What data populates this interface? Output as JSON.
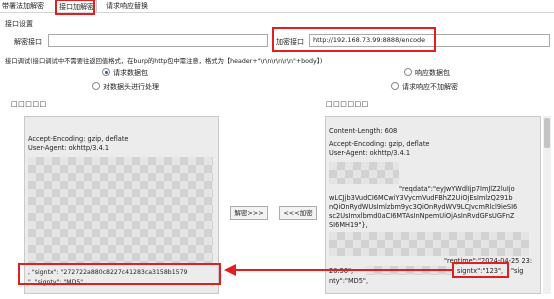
{
  "tabs": [
    {
      "label": "带署法加解密"
    },
    {
      "label": "接口加解密"
    },
    {
      "label": "请求响应替换"
    }
  ],
  "interface_settings": {
    "group_label": "接口设置",
    "decrypt_label": "解密接口",
    "decrypt_value": "",
    "encrypt_label": "加密接口",
    "encrypt_value": "http://192.168.73.99:8888/encode"
  },
  "instructions": "接口调试(接口调试中不需要往返回值格式，在burp的http包中需注意，格式为【header+\"\\r\\n\\r\\n\\r\\n\"+body】)",
  "options": {
    "request_packet": "请求数据包",
    "response_packet": "响应数据包",
    "request_header_process": "对数据头进行处理",
    "response_no_encrypt": "请求响应不加解密"
  },
  "left_panel": {
    "title": "□□□□□",
    "lines": [
      "Accept-Encoding: gzip, deflate",
      "User-Agent: okhttp/3.4.1"
    ],
    "bottom_line1": ", \"signtx\": \"272722a880c8227c41283ca3158b1579",
    "bottom_line2": "\", \"signty\": \"MD5\","
  },
  "right_panel": {
    "title": "□□□□□□",
    "content_length": "Content-Length: 608",
    "lines": [
      "Accept-Encoding: gzip, deflate",
      "User-Agent: okhttp/3.4.1"
    ],
    "reqdata": [
      "\"reqdata\":\"eyJwYWdlIjp7ImJlZ2luIjo",
      "wLCJjb3VudCI6MCwiY3VycmVudFBhZ2UiOjEsImlzQ291b",
      "nQiOnRydWUsImlzbm9yc3QiOnRydWV9LCJvcmRlcl9ieSI6",
      "sc2UsImxlbmd0aCI6MTAsInNpemUiOjAsInRvdGFsUGFnZ",
      "SI6MH19\"},"
    ],
    "reqtime": "\"reqtime\":\"2024-04-25 23:",
    "reqtime_tail": "20:56\",",
    "signtx_box": "signtx\":\"123\",",
    "signtx_tail": "\"sig",
    "bottom_line": "nty\":\"MD5\","
  },
  "buttons": {
    "decrypt": "解密>>>",
    "encrypt": "<<<加密"
  },
  "colors": {
    "highlight_box": "#e02020",
    "radio_dot": "#1f5fbf"
  }
}
